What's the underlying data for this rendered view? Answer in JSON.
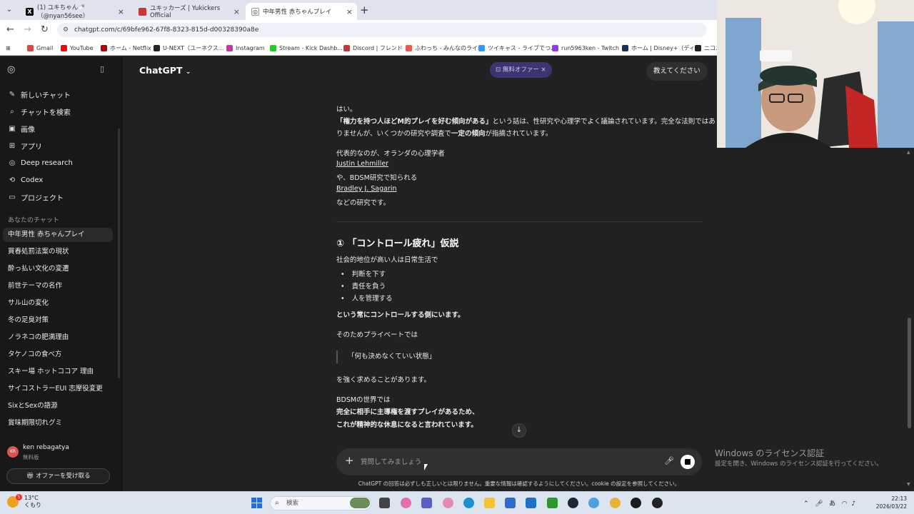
{
  "browser": {
    "tabs": [
      {
        "title": "(1) ユキちゃん🍼（@nyan56see）",
        "icon": "x-logo-icon"
      },
      {
        "title": "ユキッカーズ | Yukickers Official",
        "icon": "site-icon"
      },
      {
        "title": "中年男性 赤ちゃんプレイ",
        "icon": "chatgpt-icon"
      }
    ],
    "url": "chatgpt.com/c/69bfe962-67f8-8323-815d-d00328390a8e",
    "bookmarks": [
      "Gmail",
      "YouTube",
      "ホーム - Netflix",
      "U-NEXT（ユーネクス...",
      "Instagram",
      "Stream - Kick Dashb...",
      "Discord | フレンド",
      "ふわっち - みんなのライ...",
      "ツイキャス - ライブでつ...",
      "run5963ken - Twitch",
      "ホーム | Disney+（ディ...",
      "ニコニ"
    ]
  },
  "sidebar": {
    "nav": [
      {
        "label": "新しいチャット",
        "icon": "new-chat-icon",
        "glyph": "✎"
      },
      {
        "label": "チャットを検索",
        "icon": "search-icon",
        "glyph": "⌕"
      },
      {
        "label": "画像",
        "icon": "image-icon",
        "glyph": "▣"
      },
      {
        "label": "アプリ",
        "icon": "apps-icon",
        "glyph": "⊞"
      },
      {
        "label": "Deep research",
        "icon": "deep-research-icon",
        "glyph": "◎"
      },
      {
        "label": "Codex",
        "icon": "codex-icon",
        "glyph": "⟲"
      },
      {
        "label": "プロジェクト",
        "icon": "folder-icon",
        "glyph": "▭"
      }
    ],
    "section_label": "あなたのチャット",
    "chats": [
      "中年男性 赤ちゃんプレイ",
      "買春処罰法案の現状",
      "酔っ払い文化の変遷",
      "前世テーマの名作",
      "サル山の変化",
      "冬の足臭対策",
      "ノラネコの肥満理由",
      "タケノコの食べ方",
      "スキー場 ホットココア 理由",
      "サイコストラーEUI 志摩役変更",
      "SixとSexの語源",
      "賞味期限切れグミ"
    ],
    "user": {
      "name": "ken rebagatya",
      "plan": "無料版",
      "initials": "KR"
    },
    "offer_button": "オファーを受け取る"
  },
  "header": {
    "model": "ChatGPT",
    "offer_pill": "無料オファー",
    "action_button": "教えてください"
  },
  "message": {
    "p1": "はい。",
    "p2a": "「権力を持つ人ほどM的プレイを好む傾向がある」",
    "p2b": "という話は、性研究や心理学でよく議論されています。完全な法則ではあ",
    "p3a": "りませんが、いくつかの研究や調査で",
    "p3b": "一定の傾向",
    "p3c": "が指摘されています。",
    "p4": "代表的なのが、オランダの心理学者",
    "link1": "Justin Lehmiller",
    "p5": "や、BDSM研究で知られる",
    "link2": "Bradley J. Sagarin",
    "p6": "などの研究です。",
    "h3": "① 「コントロール疲れ」仮説",
    "p7": "社会的地位が高い人は日常生活で",
    "bullets": [
      "判断を下す",
      "責任を負う",
      "人を管理する"
    ],
    "p8": "という常にコントロールする側にいます。",
    "p9": "そのためプライベートでは",
    "quote": "「何も決めなくていい状態」",
    "p10": "を強く求めることがあります。",
    "p11": "BDSMの世界では",
    "p12": "完全に相手に主導権を渡すプレイがあるため、",
    "p13": "これが精神的な休息になると言われています。"
  },
  "composer": {
    "placeholder": "質問してみましょう",
    "footnote": "ChatGPT の回答は必ずしも正しいとは限りません。重要な情報は確認するようにしてください。cookie の設定を参照してください。"
  },
  "watermark": {
    "title": "Windows のライセンス認証",
    "subtitle": "設定を開き、Windows のライセンス認証を行ってください。"
  },
  "taskbar": {
    "temperature": "13°C",
    "weather": "くもり",
    "notification_count": "5",
    "search_placeholder": "検索",
    "time": "22:13",
    "date": "2026/03/22"
  }
}
